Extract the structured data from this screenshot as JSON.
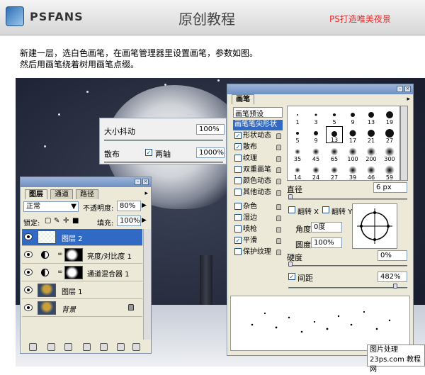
{
  "header": {
    "logo_text": "PSFANS",
    "title": "原创教程",
    "slogan": "PS打造唯美夜景"
  },
  "instructions": {
    "line1": "新建一层，选白色画笔，在画笔管理器里设置画笔，参数如图。",
    "line2": "然后用画笔绕着树用画笔点缀。"
  },
  "jitter_panel": {
    "size_jitter_label": "大小抖动",
    "size_jitter_value": "100%",
    "scatter_label": "散布",
    "both_axes_label": "两轴",
    "both_axes_checked": true,
    "scatter_value": "1000%"
  },
  "layers_panel": {
    "tabs": [
      "图层",
      "通道",
      "路径"
    ],
    "active_tab": "图层",
    "blend_mode": "正常",
    "opacity_label": "不透明度:",
    "opacity_value": "80%",
    "lock_label": "锁定:",
    "fill_label": "填充:",
    "fill_value": "100%",
    "layers": [
      {
        "name": "图层 2",
        "selected": true
      },
      {
        "name": "亮度/对比度 1",
        "selected": false
      },
      {
        "name": "通道混合器 1",
        "selected": false
      },
      {
        "name": "图层 1",
        "selected": false
      },
      {
        "name": "背景",
        "selected": false
      }
    ]
  },
  "brushes_panel": {
    "title": "画笔",
    "presets_label": "画笔预设",
    "options": [
      {
        "label": "画笔笔尖形状",
        "checked": false,
        "selected": true
      },
      {
        "label": "形状动态",
        "checked": true
      },
      {
        "label": "散布",
        "checked": true
      },
      {
        "label": "纹理",
        "checked": false
      },
      {
        "label": "双重画笔",
        "checked": false
      },
      {
        "label": "颜色动态",
        "checked": false
      },
      {
        "label": "其他动态",
        "checked": false
      },
      {
        "label": "杂色",
        "checked": false
      },
      {
        "label": "湿边",
        "checked": false
      },
      {
        "label": "喷枪",
        "checked": false
      },
      {
        "label": "平滑",
        "checked": true
      },
      {
        "label": "保护纹理",
        "checked": false
      }
    ],
    "tip_sizes": [
      "1",
      "3",
      "5",
      "9",
      "13",
      "19",
      "5",
      "9",
      "13",
      "17",
      "21",
      "27",
      "35",
      "45",
      "65",
      "100",
      "200",
      "300",
      "14",
      "24",
      "27",
      "39",
      "46",
      "59"
    ],
    "diameter_label": "直径",
    "diameter_value": "6 px",
    "flip_x_label": "翻转 X",
    "flip_y_label": "翻转 Y",
    "angle_label": "角度:",
    "angle_value": "0度",
    "roundness_label": "圆度:",
    "roundness_value": "100%",
    "hardness_label": "硬度",
    "hardness_value": "0%",
    "spacing_label": "间距",
    "spacing_checked": true,
    "spacing_value": "482%"
  },
  "watermark": {
    "line1": "图片处理",
    "line2": "23ps.com 教程网"
  }
}
